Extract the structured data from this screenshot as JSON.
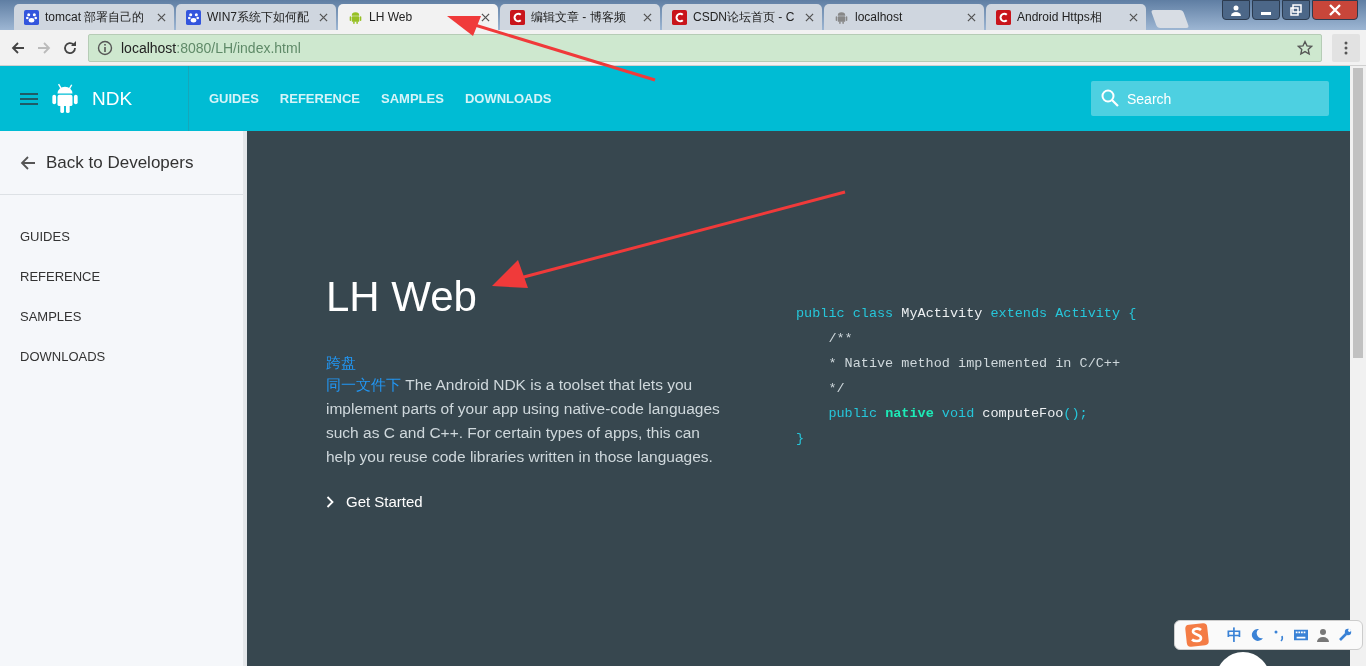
{
  "tabs": [
    {
      "title": "tomcat 部署自己的",
      "kind": "paw",
      "selected": false
    },
    {
      "title": "WIN7系统下如何配",
      "kind": "paw",
      "selected": false
    },
    {
      "title": "LH Web",
      "kind": "android",
      "selected": true
    },
    {
      "title": "编辑文章 - 博客频",
      "kind": "csdn",
      "selected": false
    },
    {
      "title": "CSDN论坛首页 - C",
      "kind": "csdn",
      "selected": false
    },
    {
      "title": "localhost",
      "kind": "android-grey",
      "selected": false
    },
    {
      "title": "Android Https相",
      "kind": "csdn",
      "selected": false
    }
  ],
  "address_bar": {
    "host": "localhost",
    "path": ":8080/LH/index.html"
  },
  "header": {
    "brand": "NDK",
    "nav": [
      "GUIDES",
      "REFERENCE",
      "SAMPLES",
      "DOWNLOADS"
    ],
    "search": {
      "placeholder": "Search"
    }
  },
  "sidebar": {
    "back": "Back to Developers",
    "items": [
      "GUIDES",
      "REFERENCE",
      "SAMPLES",
      "DOWNLOADS"
    ]
  },
  "content": {
    "title": "LH Web",
    "link_1": "跨盘",
    "link_2": "同一文件下",
    "body": "The Android NDK is a toolset that lets you implement parts of your app using native-code languages such as C and C++. For certain types of apps, this can help you reuse code libraries written in those languages.",
    "get_started": "Get Started"
  },
  "code": [
    [
      {
        "text": "public class ",
        "kind": "keyword"
      },
      {
        "text": "MyActivity ",
        "kind": "plain"
      },
      {
        "text": "extends Activity {",
        "kind": "keyword"
      }
    ],
    [
      {
        "text": "    /**",
        "kind": "comment"
      }
    ],
    [
      {
        "text": "    * Native method implemented in C/C++",
        "kind": "comment"
      }
    ],
    [
      {
        "text": "    */",
        "kind": "comment"
      }
    ],
    [
      {
        "text": "    public ",
        "kind": "keyword"
      },
      {
        "text": "native",
        "kind": "strong"
      },
      {
        "text": " void ",
        "kind": "keyword"
      },
      {
        "text": "computeFoo",
        "kind": "plain"
      },
      {
        "text": "();",
        "kind": "keyword"
      }
    ],
    [
      {
        "text": "}",
        "kind": "keyword"
      }
    ]
  ],
  "ime_bar": {
    "mode": "中"
  }
}
